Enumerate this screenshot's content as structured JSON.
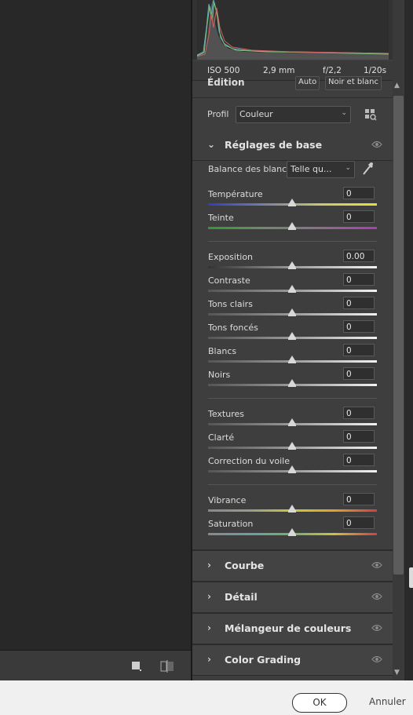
{
  "histogram": {
    "iso": "ISO 500",
    "focal": "2,9 mm",
    "aperture": "f/2,2",
    "shutter": "1/20s"
  },
  "edition": {
    "title": "Édition",
    "auto_label": "Auto",
    "bw_label": "Noir et blanc"
  },
  "profile": {
    "label": "Profil",
    "value": "Couleur"
  },
  "basic": {
    "title": "Réglages de base",
    "wb_label": "Balance des blancs",
    "wb_value": "Telle qu...",
    "sliders": {
      "temperature": {
        "label": "Température",
        "value": "0"
      },
      "tint": {
        "label": "Teinte",
        "value": "0"
      },
      "exposure": {
        "label": "Exposition",
        "value": "0.00"
      },
      "contrast": {
        "label": "Contraste",
        "value": "0"
      },
      "highlights": {
        "label": "Tons clairs",
        "value": "0"
      },
      "shadows": {
        "label": "Tons foncés",
        "value": "0"
      },
      "whites": {
        "label": "Blancs",
        "value": "0"
      },
      "blacks": {
        "label": "Noirs",
        "value": "0"
      },
      "texture": {
        "label": "Textures",
        "value": "0"
      },
      "clarity": {
        "label": "Clarté",
        "value": "0"
      },
      "dehaze": {
        "label": "Correction du voile",
        "value": "0"
      },
      "vibrance": {
        "label": "Vibrance",
        "value": "0"
      },
      "saturation": {
        "label": "Saturation",
        "value": "0"
      }
    }
  },
  "sections": {
    "curve": "Courbe",
    "detail": "Détail",
    "mixer": "Mélangeur de couleurs",
    "grading": "Color Grading"
  },
  "footer": {
    "ok_label": "OK",
    "cancel_label": "Annuler"
  },
  "colors": {
    "panel_bg": "#3e3e3e",
    "canvas_bg": "#282828",
    "footer_bg": "#f0f0f0"
  }
}
